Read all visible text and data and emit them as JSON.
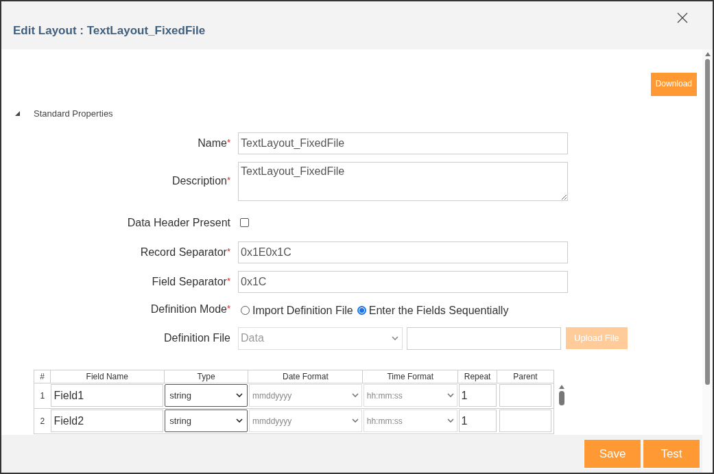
{
  "dialog": {
    "title": "Edit Layout : TextLayout_FixedFile"
  },
  "download_button": "Download",
  "section": {
    "label": "Standard Properties",
    "expanded": true
  },
  "fields": [
    {
      "kind": "text",
      "label": "Name",
      "required_mark": "*",
      "value": "TextLayout_FixedFile"
    },
    {
      "kind": "textarea",
      "label": "Description",
      "required_mark": "*",
      "value": "TextLayout_FixedFile"
    },
    {
      "kind": "checkbox",
      "label": "Data Header Present",
      "checked": false
    },
    {
      "kind": "text",
      "label": "Record Separator",
      "required_mark": "*",
      "value": "0x1E0x1C"
    },
    {
      "kind": "text",
      "label": "Field Separator",
      "required_mark": "*",
      "value": "0x1C"
    },
    {
      "kind": "radio",
      "label": "Definition Mode",
      "required_mark": "*",
      "options": [
        {
          "label": "Import Definition File",
          "selected": false
        },
        {
          "label": "Enter the Fields Sequentially",
          "selected": true
        }
      ]
    },
    {
      "kind": "file",
      "label": "Definition File",
      "select": "Data",
      "upload": "Upload File",
      "upload_disabled": true
    }
  ],
  "table": {
    "columns": [
      "#",
      "Field Name",
      "Type",
      "Date Format",
      "Time Format",
      "Repeat",
      "Parent"
    ],
    "rows": [
      {
        "index": "1",
        "name": "Field1",
        "type": "string",
        "date_format": "mmddyyyy",
        "time_format": "hh:mm:ss",
        "repeat": "1"
      },
      {
        "index": "2",
        "name": "Field2",
        "type": "string",
        "date_format": "mmddyyyy",
        "time_format": "hh:mm:ss",
        "repeat": "1"
      }
    ]
  },
  "footer_buttons": [
    "Save",
    "Test"
  ]
}
